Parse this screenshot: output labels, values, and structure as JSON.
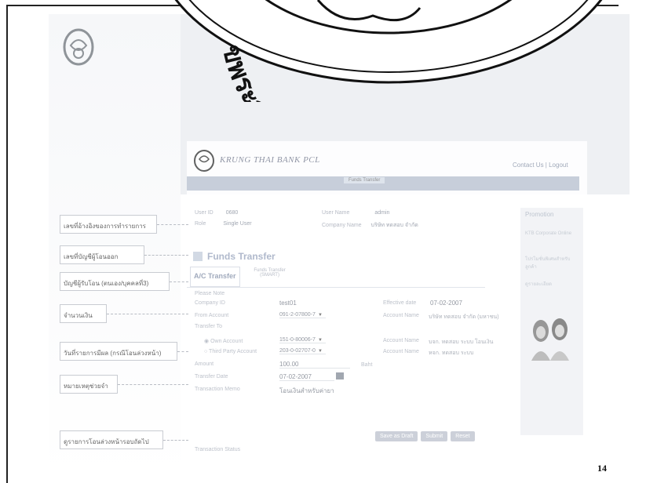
{
  "seal": {
    "arc_text": "ขพระจอมเกล้าเจ้าคุณ",
    "ring_color": "#111111"
  },
  "app": {
    "brand": "KRUNG THAI BANK PCL",
    "header_right_link": "Contact Us | Logout",
    "nav_tab": "Funds Transfer",
    "user_id_label": "User ID",
    "user_id_value": "0680",
    "role_label": "Role",
    "role_value": "Single User",
    "user_name_label": "User Name",
    "user_name_value": "admin",
    "company_name_label": "Company Name",
    "company_name_value": "บริษัท ทดสอบ จำกัด",
    "section_title": "Funds Transfer",
    "tabs": [
      {
        "label": "A/C Transfer"
      },
      {
        "label": "Funds Transfer (SMART)"
      }
    ],
    "please_note": "Please Note",
    "form": {
      "company_id_label": "Company ID",
      "company_id_value": "test01",
      "from_account_label": "From Account",
      "from_account_value": "091-2-07800-7",
      "to_label": "Transfer To",
      "own_account_label": "Own Account",
      "own_account_value": "151-0-80006-7",
      "third_party_label": "Third Party Account",
      "third_party_value": "203-0-02707-0",
      "amount_label": "Amount",
      "amount_value": "100.00",
      "amount_unit": "Baht",
      "date_label": "Transfer Date",
      "date_value": "07-02-2007",
      "memo_label": "Transaction Memo",
      "memo_value": "โอนเงินสำหรับค่ายา",
      "effective_label": "Effective date",
      "effective_value": "07-02-2007",
      "from_name_label": "Account Name",
      "from_name_value": "บริษัท ทดสอบ จำกัด (มหาชน)",
      "own_name_label": "Account Name",
      "own_name_value": "บจก. ทดสอบ ระบบ โอนเงิน",
      "third_name_label": "Account Name",
      "third_name_value": "หจก. ทดสอบ ระบบ"
    },
    "buttons": [
      "Save as Draft",
      "Submit",
      "Reset"
    ],
    "bottom_link": "Transaction Status",
    "sidebar": {
      "title": "Promotion",
      "lines": [
        "KTB Corporate Online",
        "โปรโมชั่นพิเศษสำหรับลูกค้า",
        "ดูรายละเอียด"
      ]
    }
  },
  "callouts": [
    "เลขที่อ้างอิงของการทำรายการ",
    "เลขที่บัญชีผู้โอนออก",
    "บัญชีผู้รับโอน (ตนเอง/บุคคลที่3)",
    "จำนวนเงิน",
    "วันที่รายการมีผล (กรณีโอนล่วงหน้า)",
    "หมายเหตุช่วยจำ",
    "ดูรายการโอนล่วงหน้ารอบถัดไป"
  ],
  "page_number": "14"
}
